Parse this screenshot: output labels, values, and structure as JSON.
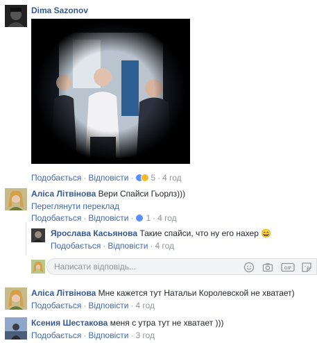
{
  "post_comment": {
    "author": "Dima Sazonov",
    "actions": {
      "like": "Подобається",
      "reply": "Відповісти",
      "reaction_count": "5",
      "time": "4 год"
    }
  },
  "comments": [
    {
      "author": "Аліса Літвінова",
      "text": "Вери Спайси Гьорлз)))",
      "translate": "Переглянути переклад",
      "actions": {
        "like": "Подобається",
        "reply": "Відповісти",
        "reaction_count": "1",
        "time": "4 год"
      }
    },
    {
      "author": "Ярослава Касьянова",
      "text": "Такие спайси, что ну его нахер",
      "emoji": "😄",
      "actions": {
        "like": "Подобається",
        "reply": "Відповісти",
        "time": "4 год"
      }
    },
    {
      "author": "Аліса Літвінова",
      "text": "Мне кажется тут Натальи Королевской не хватает)",
      "actions": {
        "like": "Подобається",
        "reply": "Відповісти",
        "time": "4 год"
      }
    },
    {
      "author": "Ксения Шестакова",
      "text": "меня с утра тут не хватает )))",
      "actions": {
        "like": "Подобається",
        "reply": "Відповісти",
        "time": "3 год"
      }
    }
  ],
  "reply_box": {
    "placeholder": "Написати відповідь...",
    "icons": [
      "emoji-icon",
      "camera-icon",
      "gif-icon",
      "sticker-icon"
    ]
  },
  "colors": {
    "link": "#4267b2",
    "author": "#365899",
    "meta": "#90949c",
    "like_badge": "#5890ff",
    "haha_badge": "#f7b928"
  }
}
